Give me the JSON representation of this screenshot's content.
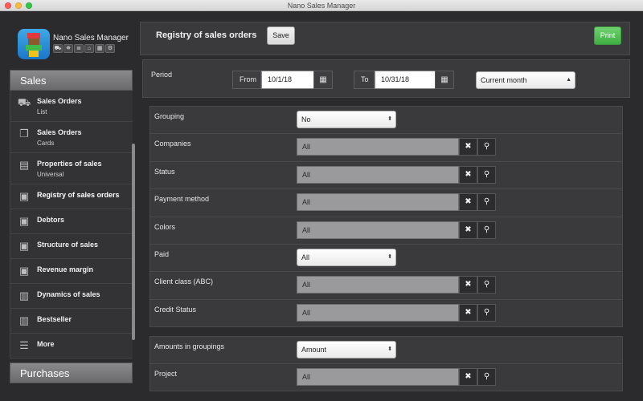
{
  "window": {
    "title": "Nano Sales Manager"
  },
  "brand": {
    "name": "Nano Sales Manager",
    "tools": [
      "truck-icon",
      "cart-icon",
      "list-icon",
      "home-icon",
      "grid-icon",
      "settings-icon"
    ]
  },
  "sidebar": {
    "section_sales": "Sales",
    "section_purchases": "Purchases",
    "items": [
      {
        "label": "Sales Orders",
        "sub": "List",
        "icon": "truck-icon"
      },
      {
        "label": "Sales Orders",
        "sub": "Cards",
        "icon": "cards-icon"
      },
      {
        "label": "Properties of sales",
        "sub": "Universal",
        "icon": "table-icon"
      },
      {
        "label": "Registry of sales orders",
        "sub": "",
        "icon": "document-icon"
      },
      {
        "label": "Debtors",
        "sub": "",
        "icon": "document-icon"
      },
      {
        "label": "Structure of sales",
        "sub": "",
        "icon": "document-icon"
      },
      {
        "label": "Revenue margin",
        "sub": "",
        "icon": "document-icon"
      },
      {
        "label": "Dynamics of sales",
        "sub": "",
        "icon": "bar-chart-icon"
      },
      {
        "label": "Bestseller",
        "sub": "",
        "icon": "bar-chart-icon"
      },
      {
        "label": "More",
        "sub": "",
        "icon": "hamburger-icon"
      }
    ]
  },
  "header": {
    "title": "Registry of sales orders",
    "save_label": "Save",
    "print_label": "Print"
  },
  "period": {
    "label": "Period",
    "from_label": "From",
    "from_value": "10/1/18",
    "to_label": "To",
    "to_value": "10/31/18",
    "preset": "Current month"
  },
  "filters": [
    {
      "label": "Grouping",
      "kind": "select",
      "value": "No"
    },
    {
      "label": "Companies",
      "kind": "lookup",
      "value": "All"
    },
    {
      "label": "Status",
      "kind": "lookup",
      "value": "All"
    },
    {
      "label": "Payment method",
      "kind": "lookup",
      "value": "All"
    },
    {
      "label": "Colors",
      "kind": "lookup",
      "value": "All"
    },
    {
      "label": "Paid",
      "kind": "select",
      "value": "All"
    },
    {
      "label": "Client class (ABC)",
      "kind": "lookup",
      "value": "All"
    },
    {
      "label": "Credit Status",
      "kind": "lookup",
      "value": "All"
    }
  ],
  "filters2": [
    {
      "label": "Amounts in groupings",
      "kind": "select",
      "value": "Amount"
    },
    {
      "label": "Project",
      "kind": "lookup",
      "value": "All"
    }
  ],
  "colors": {
    "print_button": "#4cbc4f",
    "sidebar_bg": "#333336",
    "panel_bg": "#3a3a3d"
  }
}
